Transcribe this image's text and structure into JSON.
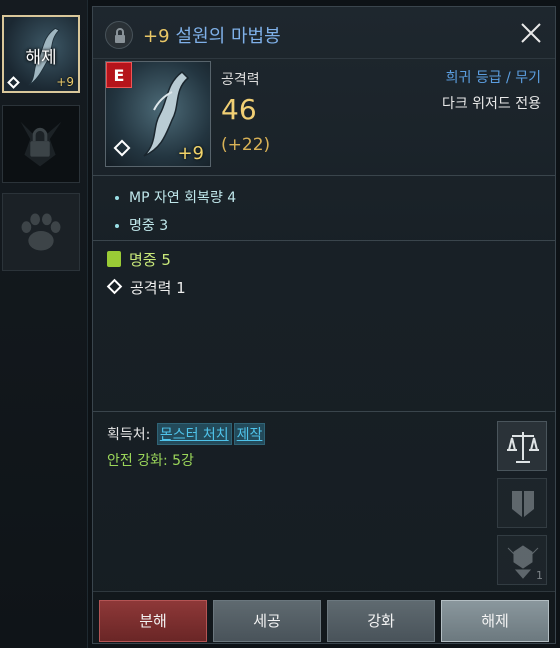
{
  "slots": {
    "slot1_label": "해제",
    "slot1_plus": "+9"
  },
  "item": {
    "plus": "+9",
    "name": "설원의 마법봉",
    "grade_badge": "E",
    "img_plus": "+9",
    "attack_label": "공격력",
    "attack_value": "46",
    "attack_bonus": "(+22)",
    "grade_text": "희귀 등급 / 무기",
    "class_text": "다크 위저드 전용"
  },
  "stats": [
    "MP 자연 회복량 4",
    "명중 3"
  ],
  "bonuses": [
    "명중 5",
    "공격력 1"
  ],
  "source": {
    "label": "획득처:",
    "links": [
      "몬스터 처치",
      "제작"
    ],
    "safe_enhance": "안전 강화: 5강"
  },
  "side_badge": "1",
  "actions": [
    "분해",
    "세공",
    "강화",
    "해제"
  ],
  "colors": {
    "grade_badge_bg": "#b5141b",
    "item_name": "#7fb0e8",
    "plus": "#e9c766",
    "attack_value": "#f1cf74",
    "grade_text": "#5b9ee0",
    "bonus1": "#c8e87a",
    "safe_text": "#9bd65a",
    "link": "#4fc3ea"
  },
  "icons": {
    "lock": "lock-icon",
    "close": "close-icon",
    "scale": "scale-icon",
    "helmet": "helmet-icon",
    "gem": "gem-icon",
    "diamond": "diamond-icon",
    "paw": "paw-icon"
  }
}
